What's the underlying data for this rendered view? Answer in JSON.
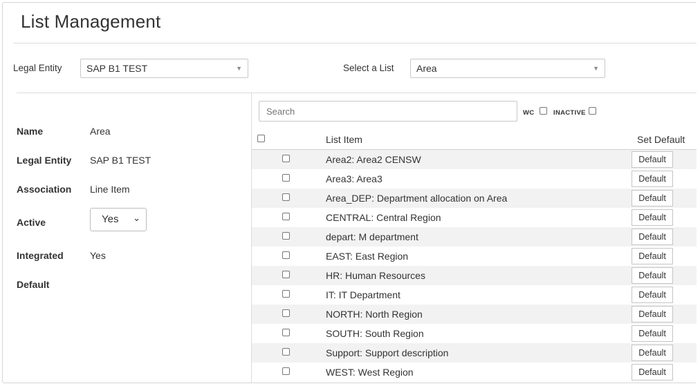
{
  "page": {
    "title": "List Management"
  },
  "filters": {
    "legal_entity_label": "Legal Entity",
    "legal_entity_value": "SAP B1 TEST",
    "select_list_label": "Select a List",
    "select_list_value": "Area"
  },
  "details": {
    "name_label": "Name",
    "name_value": "Area",
    "legal_entity_label": "Legal Entity",
    "legal_entity_value": "SAP B1 TEST",
    "association_label": "Association",
    "association_value": "Line Item",
    "active_label": "Active",
    "active_value": "Yes",
    "integrated_label": "Integrated",
    "integrated_value": "Yes",
    "default_label": "Default"
  },
  "list": {
    "search_placeholder": "Search",
    "wc_label": "WC",
    "inactive_label": "INACTIVE",
    "col_item": "List Item",
    "col_default": "Set Default",
    "default_button": "Default",
    "items": [
      "Area2: Area2 CENSW",
      "Area3: Area3",
      "Area_DEP: Department allocation on Area",
      "CENTRAL: Central Region",
      "depart: M department",
      "EAST: East Region",
      "HR: Human Resources",
      "IT: IT Department",
      "NORTH: North Region",
      "SOUTH: South Region",
      "Support: Support description",
      "WEST: West Region"
    ]
  },
  "icons": {
    "dropdown": "caret-down-icon",
    "chevron": "chevron-down-icon"
  }
}
